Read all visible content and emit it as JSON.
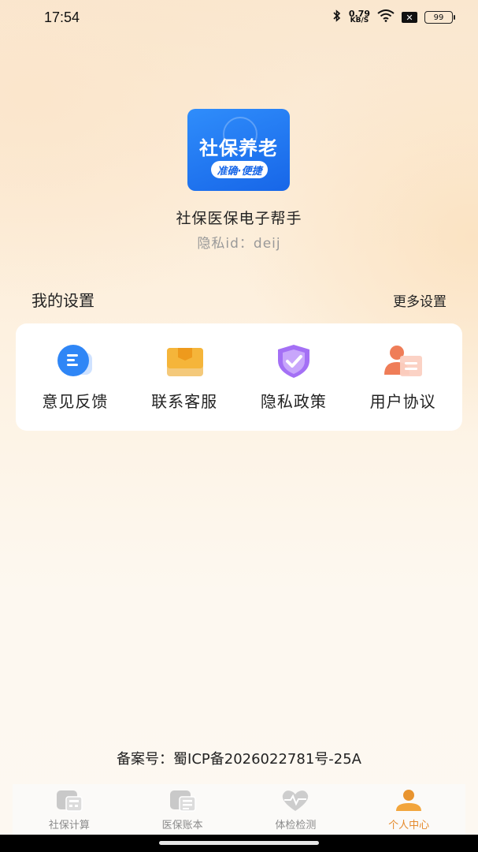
{
  "status_bar": {
    "time": "17:54",
    "net_speed_value": "0.79",
    "net_speed_unit": "KB/S",
    "battery": "99",
    "no_sim": "✕"
  },
  "profile": {
    "logo_title": "社保养老",
    "logo_badge": "准确·便捷",
    "app_name": "社保医保电子帮手",
    "privacy_id": "隐私id：deij"
  },
  "settings": {
    "title": "我的设置",
    "more_label": "更多设置",
    "items": [
      {
        "label": "意见反馈",
        "icon": "feedback-icon"
      },
      {
        "label": "联系客服",
        "icon": "customer-service-icon"
      },
      {
        "label": "隐私政策",
        "icon": "privacy-shield-icon"
      },
      {
        "label": "用户协议",
        "icon": "user-agreement-icon"
      }
    ]
  },
  "footer": {
    "icp": "备案号：蜀ICP备2026022781号-25A"
  },
  "tabs": [
    {
      "label": "社保计算",
      "icon": "calculator-icon",
      "active": false
    },
    {
      "label": "医保账本",
      "icon": "ledger-icon",
      "active": false
    },
    {
      "label": "体检检测",
      "icon": "heart-pulse-icon",
      "active": false
    },
    {
      "label": "个人中心",
      "icon": "person-icon",
      "active": true
    }
  ],
  "colors": {
    "accent": "#e58a2c",
    "logo_blue": "#1766e8",
    "background": "#fdf6ea"
  }
}
